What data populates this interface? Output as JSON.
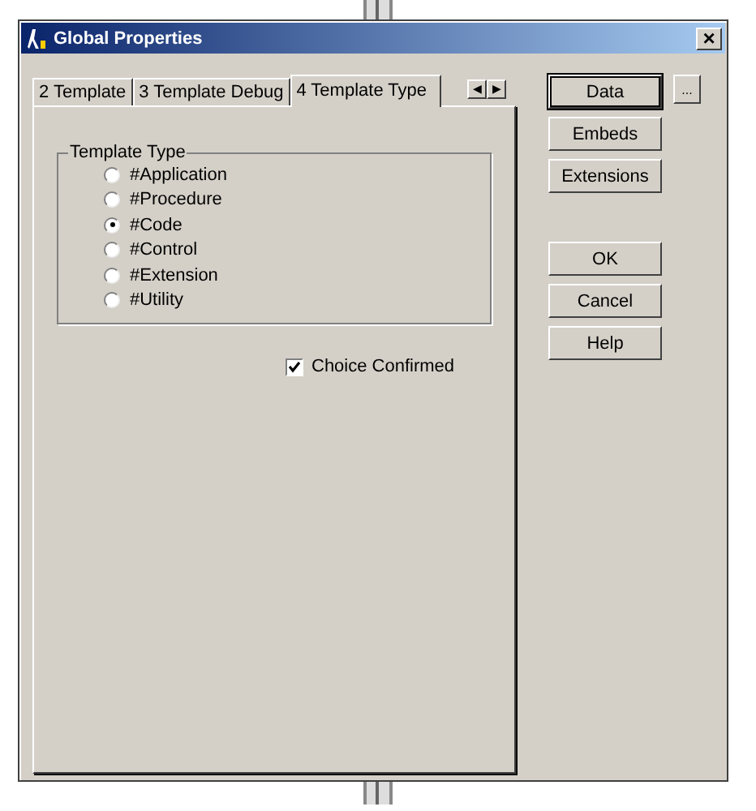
{
  "window": {
    "title": "Global Properties",
    "close": "×"
  },
  "tabs": [
    {
      "label": "2 Template",
      "selected": false
    },
    {
      "label": "3 Template Debug",
      "selected": false
    },
    {
      "label": "4 Template Type",
      "selected": true
    }
  ],
  "tab_scroll": [
    "◀",
    "▶"
  ],
  "group": {
    "title": "Template Type",
    "options": [
      {
        "label": "#Application",
        "selected": false
      },
      {
        "label": "#Procedure",
        "selected": false
      },
      {
        "label": "#Code",
        "selected": true
      },
      {
        "label": "#Control",
        "selected": false
      },
      {
        "label": "#Extension",
        "selected": false
      },
      {
        "label": "#Utility",
        "selected": false
      }
    ]
  },
  "checkbox": {
    "label": "Choice Confirmed",
    "checked": true
  },
  "side_buttons": [
    {
      "label": "Data",
      "default": true
    },
    {
      "label": "Embeds",
      "default": false
    },
    {
      "label": "Extensions",
      "default": false
    }
  ],
  "ellipsis": "...",
  "dialog_buttons": [
    "OK",
    "Cancel",
    "Help"
  ]
}
